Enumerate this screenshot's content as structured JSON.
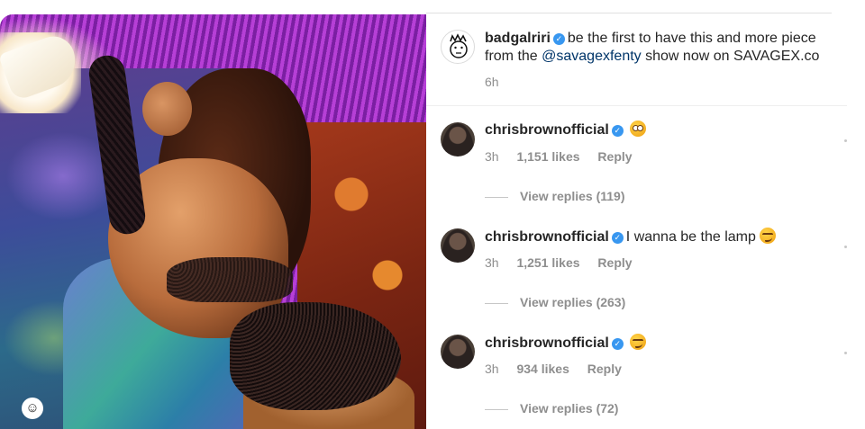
{
  "post": {
    "username": "badgalriri",
    "caption_part1": "be the first to have this and more piece",
    "caption_part2": "from the",
    "mention": "@savagexfenty",
    "caption_part3": "show now on SAVAGEX.co",
    "time": "6h"
  },
  "photo": {
    "tag_glyph": "☺"
  },
  "comments": [
    {
      "username": "chrisbrownofficial",
      "text": "",
      "emoji": "flushed-face",
      "time": "3h",
      "likes": "1,151 likes",
      "reply_label": "Reply",
      "view_replies": "View replies (119)"
    },
    {
      "username": "chrisbrownofficial",
      "text": "I wanna be the lamp",
      "emoji": "smirking-face",
      "time": "3h",
      "likes": "1,251 likes",
      "reply_label": "Reply",
      "view_replies": "View replies (263)"
    },
    {
      "username": "chrisbrownofficial",
      "text": "",
      "emoji": "smirking-face",
      "time": "3h",
      "likes": "934 likes",
      "reply_label": "Reply",
      "view_replies": "View replies (72)"
    }
  ],
  "colors": {
    "verified_badge": "#3897f0",
    "mention": "#003569",
    "secondary_text": "#8e8e8e"
  }
}
